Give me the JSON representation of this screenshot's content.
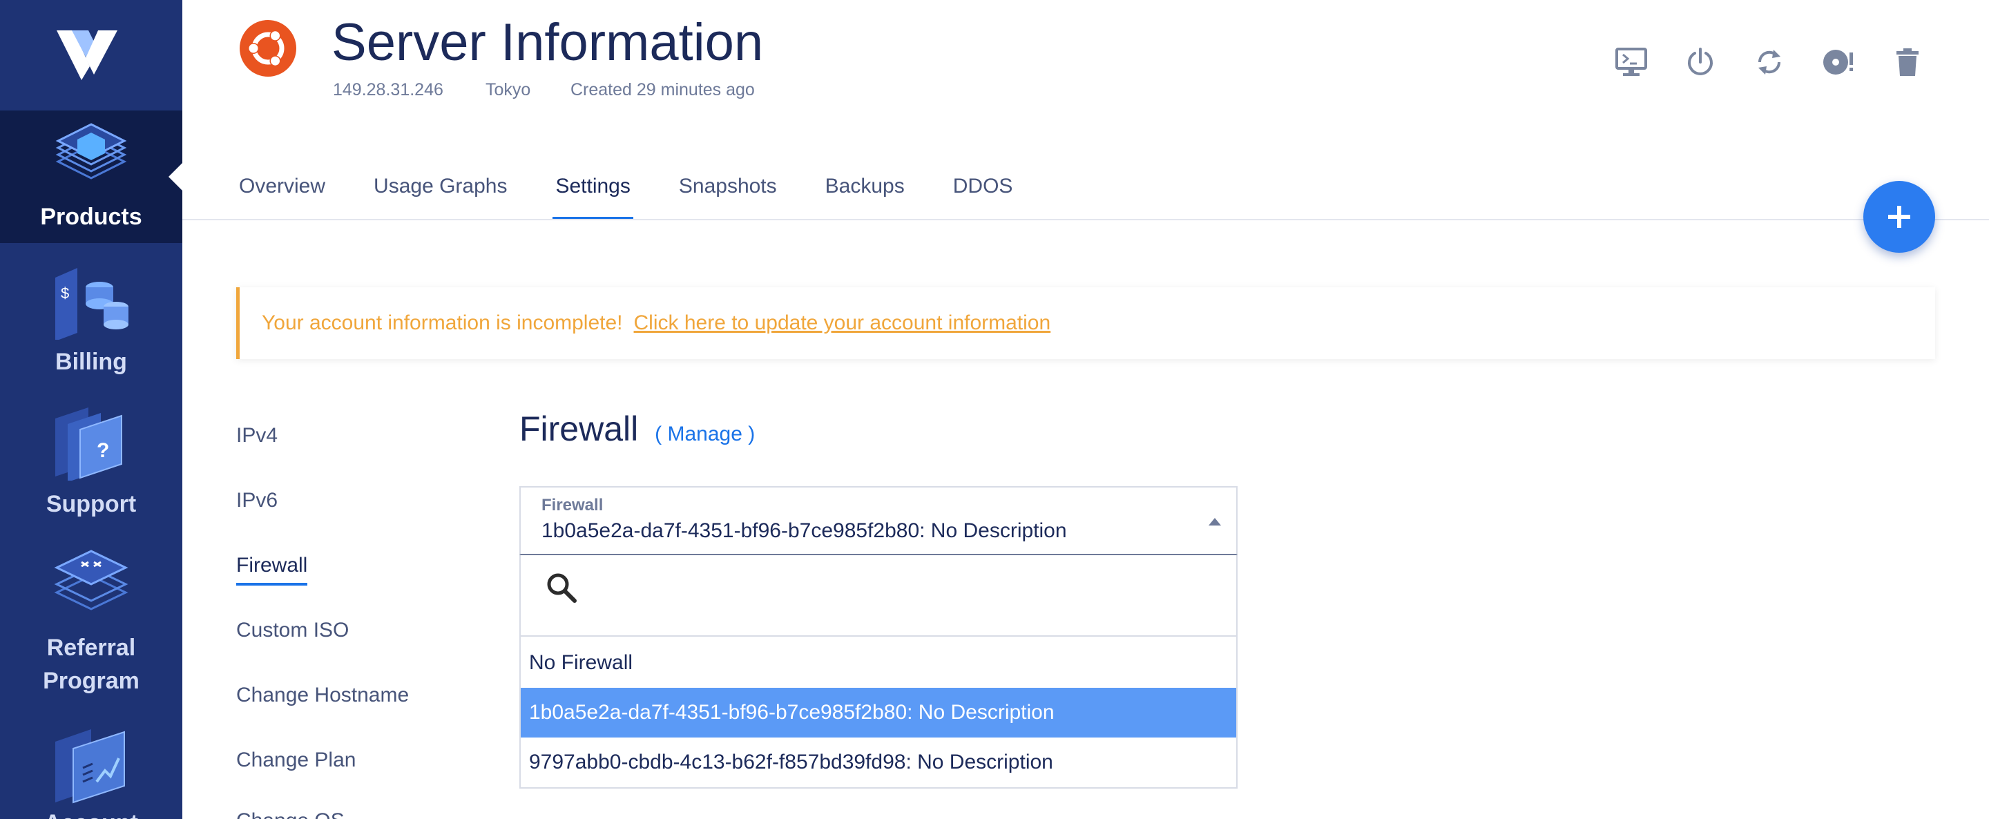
{
  "sidebar": {
    "items": [
      {
        "label": "Products",
        "active": true
      },
      {
        "label": "Billing"
      },
      {
        "label": "Support"
      },
      {
        "label": "Referral\nProgram"
      },
      {
        "label": "Account"
      }
    ]
  },
  "header": {
    "title": "Server Information",
    "ip": "149.28.31.246",
    "location": "Tokyo",
    "created": "Created 29 minutes ago",
    "os_icon": "ubuntu-logo",
    "actions": [
      "console-icon",
      "power-icon",
      "restart-icon",
      "reinstall-icon",
      "trash-icon"
    ]
  },
  "tabs": [
    {
      "label": "Overview"
    },
    {
      "label": "Usage Graphs"
    },
    {
      "label": "Settings",
      "active": true
    },
    {
      "label": "Snapshots"
    },
    {
      "label": "Backups"
    },
    {
      "label": "DDOS"
    }
  ],
  "alert": {
    "text": "Your account information is incomplete!",
    "link": "Click here to update your account information",
    "color": "#f0a63b"
  },
  "settings_nav": [
    {
      "label": "IPv4"
    },
    {
      "label": "IPv6"
    },
    {
      "label": "Firewall",
      "active": true
    },
    {
      "label": "Custom ISO"
    },
    {
      "label": "Change Hostname"
    },
    {
      "label": "Change Plan"
    },
    {
      "label": "Change OS"
    }
  ],
  "firewall": {
    "title": "Firewall",
    "manage": "( Manage )",
    "select_label": "Firewall",
    "selected_value": "1b0a5e2a-da7f-4351-bf96-b7ce985f2b80: No Description",
    "search_placeholder": "",
    "options": [
      {
        "label": "No Firewall"
      },
      {
        "label": "1b0a5e2a-da7f-4351-bf96-b7ce985f2b80: No Description",
        "selected": true
      },
      {
        "label": "9797abb0-cbdb-4c13-b62f-f857bd39fd98: No Description"
      }
    ]
  },
  "colors": {
    "sidebar": "#1e3374",
    "sidebar_active": "#0f1d4a",
    "accent": "#1a73e8",
    "fab": "#2b7cf0",
    "selected_option": "#5b9af6"
  }
}
